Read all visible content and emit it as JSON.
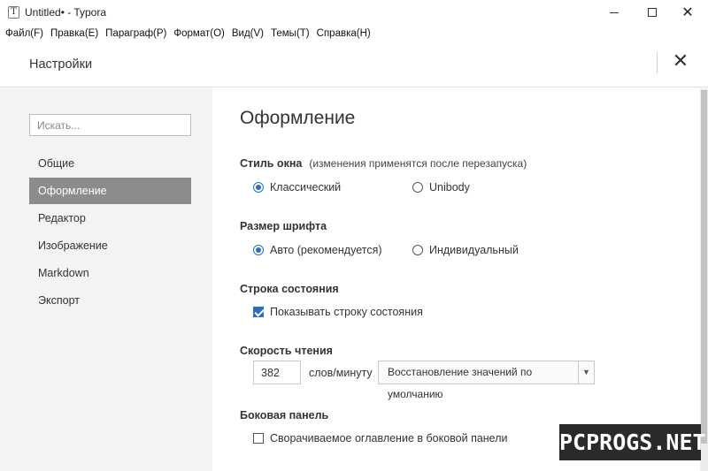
{
  "window": {
    "title": "Untitled• - Typora",
    "app_icon": "T",
    "icons": {
      "minimize": "minimize-icon",
      "maximize": "maximize-icon",
      "close": "close-icon"
    },
    "close_glyph": "✕"
  },
  "menu": {
    "items": [
      {
        "label": "Файл(F)"
      },
      {
        "label": "Правка(E)"
      },
      {
        "label": "Параграф(P)"
      },
      {
        "label": "Формат(O)"
      },
      {
        "label": "Вид(V)"
      },
      {
        "label": "Темы(T)"
      },
      {
        "label": "Справка(H)"
      }
    ]
  },
  "settings": {
    "title": "Настройки",
    "close_glyph": "✕"
  },
  "sidebar": {
    "search_placeholder": "Искать...",
    "items": [
      {
        "label": "Общие",
        "active": false
      },
      {
        "label": "Оформление",
        "active": true
      },
      {
        "label": "Редактор",
        "active": false
      },
      {
        "label": "Изображение",
        "active": false
      },
      {
        "label": "Markdown",
        "active": false
      },
      {
        "label": "Экспорт",
        "active": false
      }
    ]
  },
  "content": {
    "page_title": "Оформление",
    "window_style": {
      "title": "Стиль окна",
      "note": "(изменения применятся после перезапуска)",
      "options": [
        {
          "label": "Классический",
          "checked": true
        },
        {
          "label": "Unibody",
          "checked": false
        }
      ]
    },
    "font_size": {
      "title": "Размер шрифта",
      "options": [
        {
          "label": "Авто (рекомендуется)",
          "checked": true
        },
        {
          "label": "Индивидуальный",
          "checked": false
        }
      ]
    },
    "status_bar": {
      "title": "Строка состояния",
      "checkbox": {
        "label": "Показывать строку состояния",
        "checked": true
      }
    },
    "reading_speed": {
      "title": "Скорость чтения",
      "value": "382",
      "unit": "слов/минуту",
      "reset_label": "Восстановление значений по умолчанию",
      "dropdown_glyph": "▼"
    },
    "sidebar_panel": {
      "title": "Боковая панель",
      "checkbox": {
        "label": "Сворачиваемое оглавление в боковой панели",
        "checked": false
      }
    }
  },
  "watermark": "PCPROGS.NET",
  "colors": {
    "accent": "#2b6fc2",
    "active_nav": "#8c8c8c",
    "sidebar_bg": "#f3f3f3"
  }
}
